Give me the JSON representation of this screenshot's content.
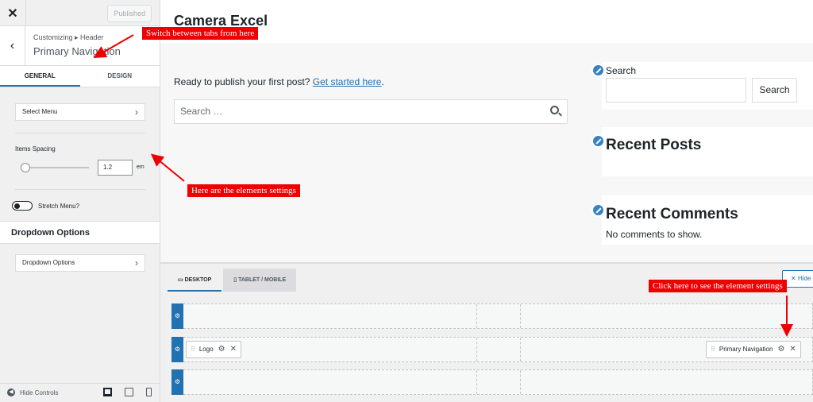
{
  "sidebar": {
    "close_icon": "close-icon",
    "published_label": "Published",
    "back_icon": "chevron-left-icon",
    "breadcrumb": "Customizing ▸ Header",
    "title": "Primary Navigation",
    "tabs": [
      "General",
      "Design"
    ],
    "select_menu_label": "Select Menu",
    "items_spacing_label": "Items Spacing",
    "items_spacing_value": "1.2",
    "items_spacing_unit": "em",
    "stretch_menu_label": "Stretch Menu?",
    "dropdown_section_title": "Dropdown Options",
    "dropdown_options_label": "Dropdown Options",
    "hide_controls_label": "Hide Controls"
  },
  "preview": {
    "site_title": "Camera Excel",
    "ready_text": "Ready to publish your first post?",
    "get_started_link": "Get started here",
    "ready_period": ".",
    "search_placeholder": "Search …",
    "search_widget_label": "Search",
    "search_button": "Search",
    "recent_posts_heading": "Recent Posts",
    "recent_comments_heading": "Recent Comments",
    "no_comments_text": "No comments to show."
  },
  "builder": {
    "tabs": [
      "Desktop",
      "Tablet / Mobile"
    ],
    "hide_label": "Hide",
    "logo_chip": "Logo",
    "primary_nav_chip": "Primary Navigation"
  },
  "annotations": {
    "tabs_note": "Switch between tabs from here",
    "elements_note": "Here are the elements settings",
    "click_note": "Click here to see the element settings"
  },
  "colors": {
    "accent": "#2271b1",
    "annotation": "#e00000"
  }
}
